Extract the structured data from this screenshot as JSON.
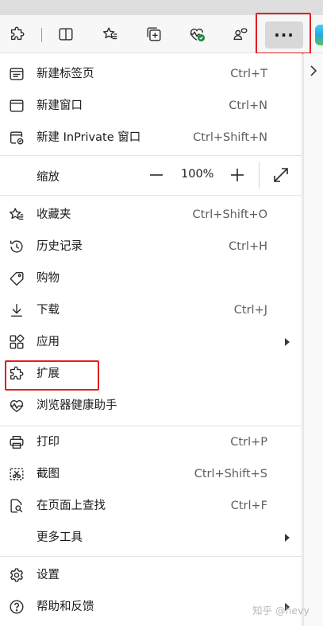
{
  "toolbar": {
    "more_label": "···"
  },
  "menu": {
    "groups": [
      [
        {
          "label": "新建标签页",
          "shortcut": "Ctrl+T",
          "icon": "new-tab-icon"
        },
        {
          "label": "新建窗口",
          "shortcut": "Ctrl+N",
          "icon": "new-window-icon"
        },
        {
          "label": "新建 InPrivate 窗口",
          "shortcut": "Ctrl+Shift+N",
          "icon": "inprivate-icon"
        }
      ],
      [
        {
          "label": "收藏夹",
          "shortcut": "Ctrl+Shift+O",
          "icon": "favorites-icon"
        },
        {
          "label": "历史记录",
          "shortcut": "Ctrl+H",
          "icon": "history-icon"
        },
        {
          "label": "购物",
          "shortcut": "",
          "icon": "shopping-tag-icon"
        },
        {
          "label": "下载",
          "shortcut": "Ctrl+J",
          "icon": "download-icon"
        },
        {
          "label": "应用",
          "shortcut": "",
          "icon": "apps-icon",
          "submenu": true
        },
        {
          "label": "扩展",
          "shortcut": "",
          "icon": "extensions-icon"
        },
        {
          "label": "浏览器健康助手",
          "shortcut": "",
          "icon": "browser-health-icon"
        }
      ],
      [
        {
          "label": "打印",
          "shortcut": "Ctrl+P",
          "icon": "print-icon"
        },
        {
          "label": "截图",
          "shortcut": "Ctrl+Shift+S",
          "icon": "screenshot-icon"
        },
        {
          "label": "在页面上查找",
          "shortcut": "Ctrl+F",
          "icon": "find-on-page-icon"
        },
        {
          "label": "更多工具",
          "shortcut": "",
          "icon": "",
          "submenu": true
        }
      ],
      [
        {
          "label": "设置",
          "shortcut": "",
          "icon": "settings-icon"
        },
        {
          "label": "帮助和反馈",
          "shortcut": "",
          "icon": "help-icon",
          "submenu": true
        }
      ]
    ],
    "zoom": {
      "label": "缩放",
      "value": "100%",
      "minus": "—",
      "plus": "+"
    }
  },
  "watermark": "知乎 @hevy",
  "colors": {
    "highlight": "#e02020",
    "menu_bg": "#ffffff",
    "toolbar_bg": "#f7f7f7"
  }
}
